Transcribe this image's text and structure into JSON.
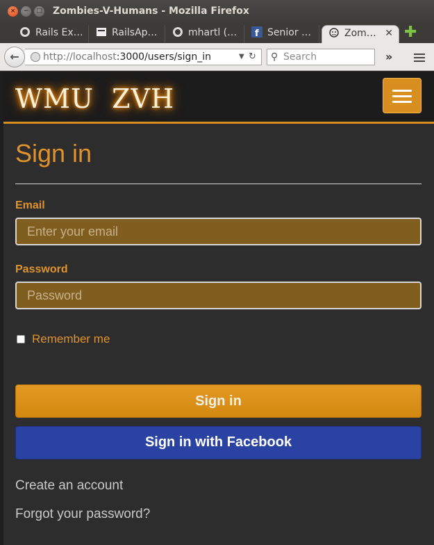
{
  "window": {
    "title": "Zombies-V-Humans - Mozilla Firefox"
  },
  "tabs": [
    {
      "label": "Rails Ex…",
      "icon": "github-icon"
    },
    {
      "label": "RailsAp…",
      "icon": "page-icon"
    },
    {
      "label": "mhartl (…",
      "icon": "github-icon"
    },
    {
      "label": "Senior …",
      "icon": "facebook-icon"
    },
    {
      "label": "Zom…",
      "icon": "zombie-icon",
      "active": true
    }
  ],
  "navbar": {
    "url_host": "http://localhost",
    "url_path": ":3000/users/sign_in",
    "search_placeholder": "Search"
  },
  "app": {
    "logo": "WMU  ZVH",
    "accent": "#d9901e"
  },
  "form": {
    "heading": "Sign in",
    "email_label": "Email",
    "email_placeholder": "Enter your email",
    "password_label": "Password",
    "password_placeholder": "Password",
    "remember_label": "Remember me",
    "remember_checked": false,
    "submit_label": "Sign in",
    "facebook_label": "Sign in with Facebook"
  },
  "links": {
    "create_account": "Create an account",
    "forgot_password": "Forgot your password?"
  }
}
